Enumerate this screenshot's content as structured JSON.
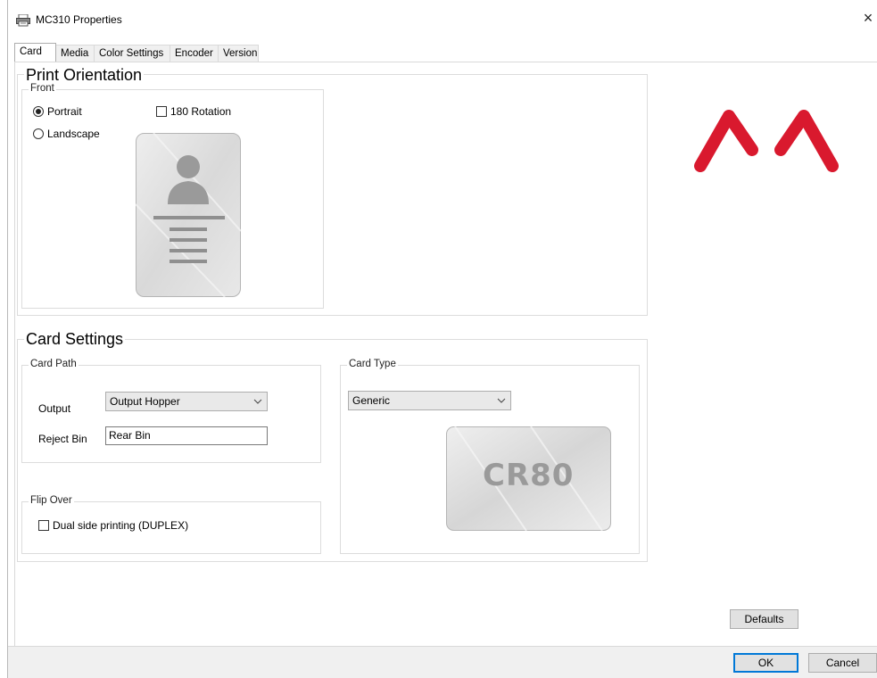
{
  "window": {
    "title": "MC310 Properties",
    "close_glyph": "×"
  },
  "tabs": [
    {
      "label": "Card",
      "active": true
    },
    {
      "label": "Media"
    },
    {
      "label": "Color Settings"
    },
    {
      "label": "Encoder"
    },
    {
      "label": "Version"
    }
  ],
  "print_orientation": {
    "title": "Print Orientation",
    "front_label": "Front",
    "portrait_label": "Portrait",
    "portrait_selected": true,
    "landscape_label": "Landscape",
    "landscape_selected": false,
    "rotation_label": "180 Rotation",
    "rotation_checked": false
  },
  "card_settings": {
    "title": "Card Settings",
    "card_path": {
      "title": "Card Path",
      "output_label": "Output",
      "output_value": "Output Hopper",
      "reject_label": "Reject Bin",
      "reject_value": "Rear Bin"
    },
    "flip_over": {
      "title": "Flip Over",
      "duplex_label": "Dual side printing (DUPLEX)",
      "duplex_checked": false
    },
    "card_type": {
      "title": "Card Type",
      "value": "Generic",
      "card_image_text": "CR80"
    }
  },
  "buttons": {
    "defaults": "Defaults",
    "ok": "OK",
    "cancel": "Cancel"
  },
  "colors": {
    "brand_red": "#d9192e",
    "focus_blue": "#0078d7"
  },
  "icons": {
    "title_icon": "printer-icon",
    "close_icon": "close-icon",
    "logo": "brand-logo"
  }
}
